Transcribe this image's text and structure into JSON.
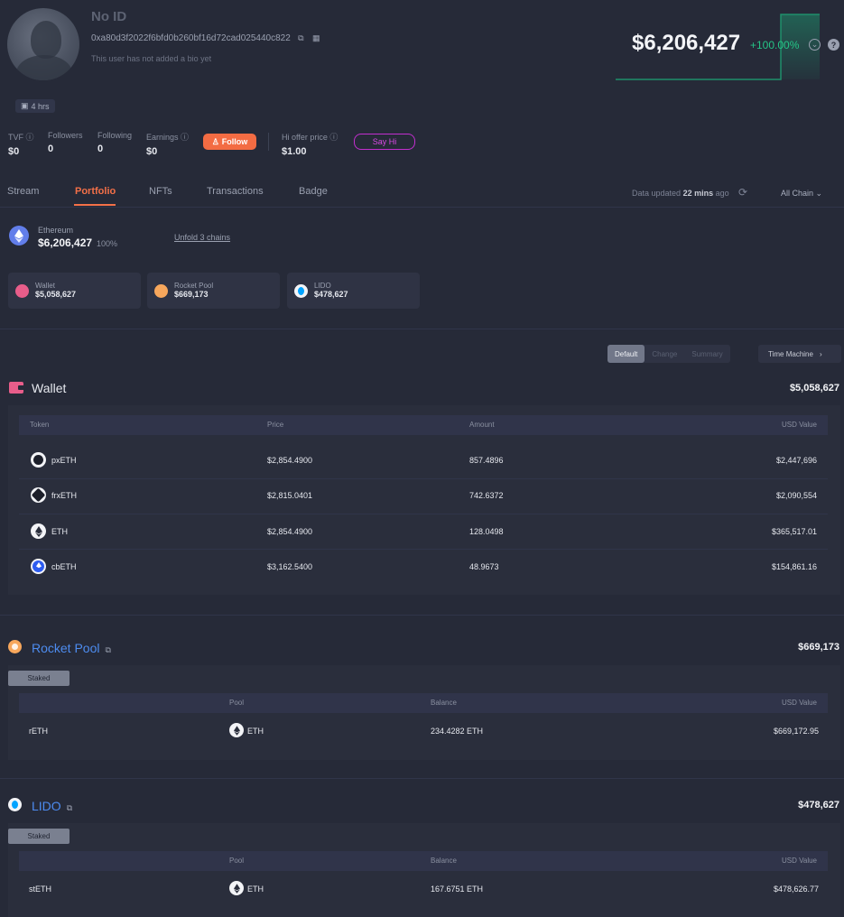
{
  "profile": {
    "name": "No ID",
    "address": "0xa80d3f2022f6bfd0b260bf16d72cad025440c822",
    "bio": "This user has not added a bio yet",
    "active": "4 hrs"
  },
  "stats": [
    {
      "label": "TVF",
      "value": "$0"
    },
    {
      "label": "Followers",
      "value": "0"
    },
    {
      "label": "Following",
      "value": "0"
    },
    {
      "label": "Earnings",
      "value": "$0"
    }
  ],
  "follow_label": "Follow",
  "hi_offer": {
    "label": "Hi offer price",
    "value": "$1.00"
  },
  "say_hi_label": "Say Hi",
  "net_worth": {
    "value": "$6,206,427",
    "change": "+100.00%"
  },
  "tabs": [
    "Stream",
    "Portfolio",
    "NFTs",
    "Transactions",
    "Badge"
  ],
  "active_tab": "Portfolio",
  "updated": {
    "prefix": "Data updated",
    "time": "22 mins",
    "suffix": "ago"
  },
  "chain_filter": "All Chain",
  "chain": {
    "name": "Ethereum",
    "value": "$6,206,427",
    "percent": "100%",
    "unfold": "Unfold 3 chains"
  },
  "protocol_cards": [
    {
      "name": "Wallet",
      "value": "$5,058,627",
      "icon": "wallet-icon"
    },
    {
      "name": "Rocket Pool",
      "value": "$669,173",
      "icon": "rocket-pool-icon"
    },
    {
      "name": "LIDO",
      "value": "$478,627",
      "icon": "lido-icon"
    }
  ],
  "view_modes": [
    "Default",
    "Change",
    "Summary"
  ],
  "time_machine": "Time Machine",
  "wallet": {
    "title": "Wallet",
    "total": "$5,058,627",
    "columns": [
      "Token",
      "Price",
      "Amount",
      "USD Value"
    ],
    "rows": [
      {
        "token": "pxETH",
        "price": "$2,854.4900",
        "amount": "857.4896",
        "usd": "$2,447,696"
      },
      {
        "token": "frxETH",
        "price": "$2,815.0401",
        "amount": "742.6372",
        "usd": "$2,090,554"
      },
      {
        "token": "ETH",
        "price": "$2,854.4900",
        "amount": "128.0498",
        "usd": "$365,517.01"
      },
      {
        "token": "cbETH",
        "price": "$3,162.5400",
        "amount": "48.9673",
        "usd": "$154,861.16"
      }
    ]
  },
  "rocket_pool": {
    "title": "Rocket Pool",
    "total": "$669,173",
    "tag": "Staked",
    "columns": [
      "Pool",
      "Balance",
      "USD Value"
    ],
    "row": {
      "name": "rETH",
      "pool": "ETH",
      "balance": "234.4282 ETH",
      "usd": "$669,172.95"
    }
  },
  "lido": {
    "title": "LIDO",
    "total": "$478,627",
    "tag": "Staked",
    "columns": [
      "Pool",
      "Balance",
      "USD Value"
    ],
    "row": {
      "name": "stETH",
      "pool": "ETH",
      "balance": "167.6751 ETH",
      "usd": "$478,626.77"
    }
  },
  "colors": {
    "accent": "#f47048",
    "positive": "#25c486",
    "link": "#4d8cf0",
    "say_hi": "#c22fcf"
  }
}
